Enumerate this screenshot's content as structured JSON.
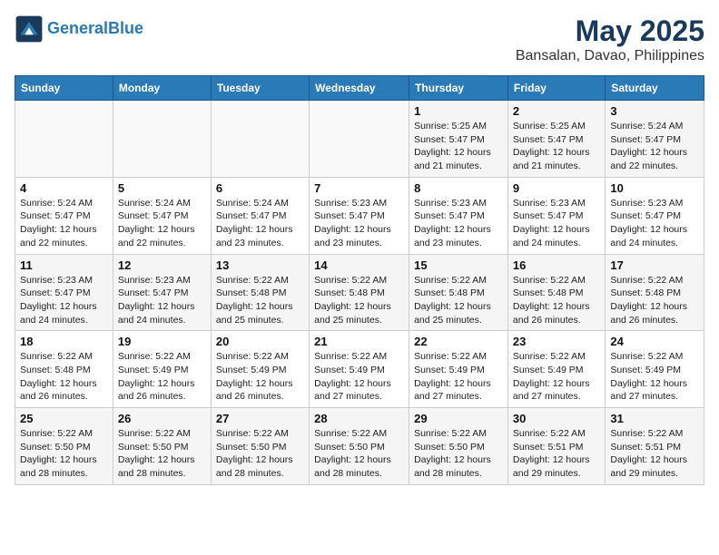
{
  "app": {
    "name": "GeneralBlue",
    "logo_text_1": "General",
    "logo_text_2": "Blue"
  },
  "calendar": {
    "title": "May 2025",
    "subtitle": "Bansalan, Davao, Philippines",
    "headers": [
      "Sunday",
      "Monday",
      "Tuesday",
      "Wednesday",
      "Thursday",
      "Friday",
      "Saturday"
    ],
    "weeks": [
      [
        {
          "day": "",
          "info": ""
        },
        {
          "day": "",
          "info": ""
        },
        {
          "day": "",
          "info": ""
        },
        {
          "day": "",
          "info": ""
        },
        {
          "day": "1",
          "info": "Sunrise: 5:25 AM\nSunset: 5:47 PM\nDaylight: 12 hours\nand 21 minutes."
        },
        {
          "day": "2",
          "info": "Sunrise: 5:25 AM\nSunset: 5:47 PM\nDaylight: 12 hours\nand 21 minutes."
        },
        {
          "day": "3",
          "info": "Sunrise: 5:24 AM\nSunset: 5:47 PM\nDaylight: 12 hours\nand 22 minutes."
        }
      ],
      [
        {
          "day": "4",
          "info": "Sunrise: 5:24 AM\nSunset: 5:47 PM\nDaylight: 12 hours\nand 22 minutes."
        },
        {
          "day": "5",
          "info": "Sunrise: 5:24 AM\nSunset: 5:47 PM\nDaylight: 12 hours\nand 22 minutes."
        },
        {
          "day": "6",
          "info": "Sunrise: 5:24 AM\nSunset: 5:47 PM\nDaylight: 12 hours\nand 23 minutes."
        },
        {
          "day": "7",
          "info": "Sunrise: 5:23 AM\nSunset: 5:47 PM\nDaylight: 12 hours\nand 23 minutes."
        },
        {
          "day": "8",
          "info": "Sunrise: 5:23 AM\nSunset: 5:47 PM\nDaylight: 12 hours\nand 23 minutes."
        },
        {
          "day": "9",
          "info": "Sunrise: 5:23 AM\nSunset: 5:47 PM\nDaylight: 12 hours\nand 24 minutes."
        },
        {
          "day": "10",
          "info": "Sunrise: 5:23 AM\nSunset: 5:47 PM\nDaylight: 12 hours\nand 24 minutes."
        }
      ],
      [
        {
          "day": "11",
          "info": "Sunrise: 5:23 AM\nSunset: 5:47 PM\nDaylight: 12 hours\nand 24 minutes."
        },
        {
          "day": "12",
          "info": "Sunrise: 5:23 AM\nSunset: 5:47 PM\nDaylight: 12 hours\nand 24 minutes."
        },
        {
          "day": "13",
          "info": "Sunrise: 5:22 AM\nSunset: 5:48 PM\nDaylight: 12 hours\nand 25 minutes."
        },
        {
          "day": "14",
          "info": "Sunrise: 5:22 AM\nSunset: 5:48 PM\nDaylight: 12 hours\nand 25 minutes."
        },
        {
          "day": "15",
          "info": "Sunrise: 5:22 AM\nSunset: 5:48 PM\nDaylight: 12 hours\nand 25 minutes."
        },
        {
          "day": "16",
          "info": "Sunrise: 5:22 AM\nSunset: 5:48 PM\nDaylight: 12 hours\nand 26 minutes."
        },
        {
          "day": "17",
          "info": "Sunrise: 5:22 AM\nSunset: 5:48 PM\nDaylight: 12 hours\nand 26 minutes."
        }
      ],
      [
        {
          "day": "18",
          "info": "Sunrise: 5:22 AM\nSunset: 5:48 PM\nDaylight: 12 hours\nand 26 minutes."
        },
        {
          "day": "19",
          "info": "Sunrise: 5:22 AM\nSunset: 5:49 PM\nDaylight: 12 hours\nand 26 minutes."
        },
        {
          "day": "20",
          "info": "Sunrise: 5:22 AM\nSunset: 5:49 PM\nDaylight: 12 hours\nand 26 minutes."
        },
        {
          "day": "21",
          "info": "Sunrise: 5:22 AM\nSunset: 5:49 PM\nDaylight: 12 hours\nand 27 minutes."
        },
        {
          "day": "22",
          "info": "Sunrise: 5:22 AM\nSunset: 5:49 PM\nDaylight: 12 hours\nand 27 minutes."
        },
        {
          "day": "23",
          "info": "Sunrise: 5:22 AM\nSunset: 5:49 PM\nDaylight: 12 hours\nand 27 minutes."
        },
        {
          "day": "24",
          "info": "Sunrise: 5:22 AM\nSunset: 5:49 PM\nDaylight: 12 hours\nand 27 minutes."
        }
      ],
      [
        {
          "day": "25",
          "info": "Sunrise: 5:22 AM\nSunset: 5:50 PM\nDaylight: 12 hours\nand 28 minutes."
        },
        {
          "day": "26",
          "info": "Sunrise: 5:22 AM\nSunset: 5:50 PM\nDaylight: 12 hours\nand 28 minutes."
        },
        {
          "day": "27",
          "info": "Sunrise: 5:22 AM\nSunset: 5:50 PM\nDaylight: 12 hours\nand 28 minutes."
        },
        {
          "day": "28",
          "info": "Sunrise: 5:22 AM\nSunset: 5:50 PM\nDaylight: 12 hours\nand 28 minutes."
        },
        {
          "day": "29",
          "info": "Sunrise: 5:22 AM\nSunset: 5:50 PM\nDaylight: 12 hours\nand 28 minutes."
        },
        {
          "day": "30",
          "info": "Sunrise: 5:22 AM\nSunset: 5:51 PM\nDaylight: 12 hours\nand 29 minutes."
        },
        {
          "day": "31",
          "info": "Sunrise: 5:22 AM\nSunset: 5:51 PM\nDaylight: 12 hours\nand 29 minutes."
        }
      ]
    ]
  }
}
